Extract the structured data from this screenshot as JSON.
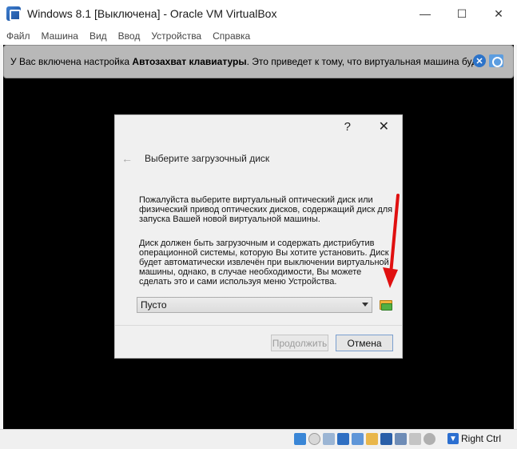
{
  "window": {
    "title": "Windows 8.1 [Выключена] - Oracle VM VirtualBox",
    "minimize_glyph": "—",
    "maximize_glyph": "☐",
    "close_glyph": "✕"
  },
  "menu": {
    "items": [
      "Файл",
      "Машина",
      "Вид",
      "Ввод",
      "Устройства",
      "Справка"
    ]
  },
  "notice": {
    "text_before": "У Вас включена настройка ",
    "text_bold": "Автозахват клавиатуры",
    "text_after": ". Это приведет к тому, что виртуальная машина будет"
  },
  "dialog": {
    "help_glyph": "?",
    "close_glyph": "✕",
    "back_glyph": "←",
    "heading": "Выберите загрузочный диск",
    "paragraph1": "Пожалуйста выберите виртуальный оптический диск или физический привод оптических дисков, содержащий диск для запуска Вашей новой виртуальной машины.",
    "paragraph2": "Диск должен быть загрузочным и содержать дистрибутив операционной системы, которую Вы хотите установить. Диск будет автоматически извлечён при выключении виртуальной машины, однако, в случае необходимости, Вы можете сделать это и сами используя меню Устройства.",
    "combo_value": "Пусто",
    "continue_label": "Продолжить",
    "cancel_label": "Отмена"
  },
  "statusbar": {
    "host_key_label": "Right Ctrl"
  },
  "colors": {
    "vm_background": "#000000",
    "notice_background": "#b8b8b8",
    "arrow": "#e01010",
    "accent": "#2c73c9"
  },
  "icons": {
    "app": "virtualbox-icon",
    "folder": "folder-open-icon",
    "annotation": "red-arrow-annotation"
  }
}
